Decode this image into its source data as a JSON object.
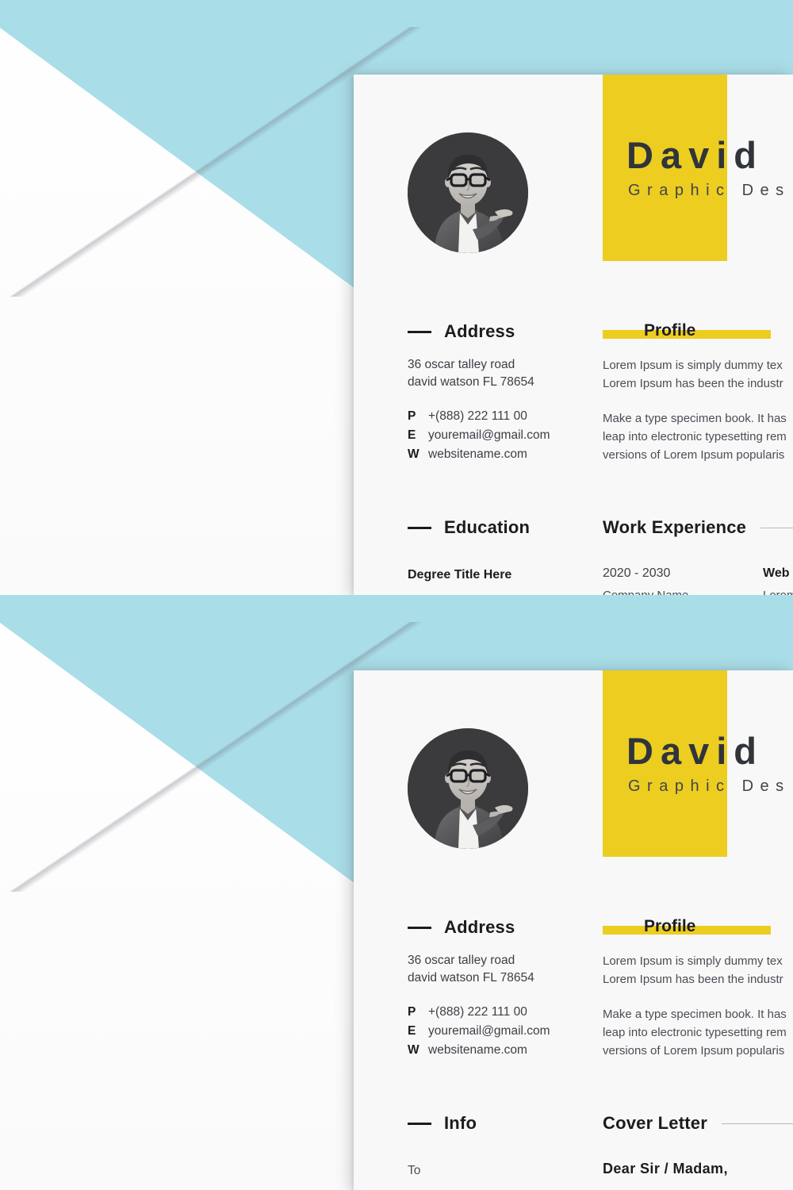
{
  "colors": {
    "teal_background": "#a9dee8",
    "accent_yellow": "#eccd20",
    "card_background": "#f8f8f8",
    "heading_dark": "#1c1c1e",
    "body_text": "#4a4e55",
    "page_background": "#ffffff"
  },
  "resume": {
    "name": "David",
    "role": "Graphic Des",
    "avatar_alt": "portrait-photo",
    "address": {
      "heading": "Address",
      "line1": "36 oscar talley road",
      "line2": "david watson FL 78654",
      "contacts": [
        {
          "key": "P",
          "value": "+(888) 222 111 00"
        },
        {
          "key": "E",
          "value": "youremail@gmail.com"
        },
        {
          "key": "W",
          "value": "websitename.com"
        }
      ]
    },
    "profile": {
      "heading": "Profile",
      "paragraph1_line1": "Lorem Ipsum is simply dummy tex",
      "paragraph1_line2": "Lorem Ipsum has been the industr",
      "paragraph2_line1": "Make a type specimen book. It has",
      "paragraph2_line2": "leap into electronic typesetting rem",
      "paragraph2_line3": "versions of Lorem Ipsum popularis"
    },
    "education": {
      "heading": "Education",
      "degree_title": "Degree Title Here"
    },
    "work_experience": {
      "heading": "Work Experience",
      "date_range": "2020 - 2030",
      "company": "Company Name",
      "job_title": "Web Desi",
      "description": "Lorem ip"
    },
    "info": {
      "heading": "Info",
      "to_label": "To"
    },
    "cover_letter": {
      "heading": "Cover Letter",
      "salutation": "Dear Sir / Madam,"
    }
  }
}
